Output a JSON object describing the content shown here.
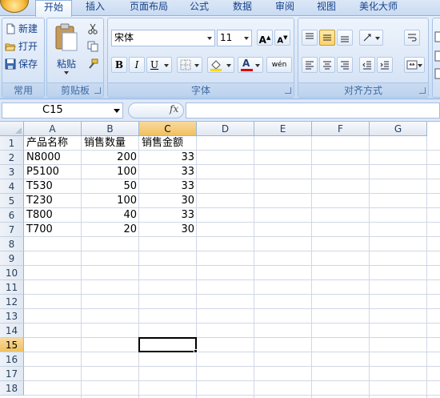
{
  "tabs": [
    {
      "label": "开始",
      "active": true
    },
    {
      "label": "插入",
      "active": false
    },
    {
      "label": "页面布局",
      "active": false
    },
    {
      "label": "公式",
      "active": false
    },
    {
      "label": "数据",
      "active": false
    },
    {
      "label": "审阅",
      "active": false
    },
    {
      "label": "视图",
      "active": false
    },
    {
      "label": "美化大师",
      "active": false
    }
  ],
  "groups": {
    "common": {
      "label": "常用",
      "new_label": "新建",
      "open_label": "打开",
      "save_label": "保存"
    },
    "clipboard": {
      "label": "剪贴板",
      "paste_label": "粘贴"
    },
    "font": {
      "label": "字体",
      "font_name": "宋体",
      "font_size": "11",
      "bold": "B",
      "italic": "I",
      "underline": "U",
      "grow": "A",
      "shrink": "A",
      "font_color_glyph": "A",
      "phonetic": "wén"
    },
    "alignment": {
      "label": "对齐方式"
    }
  },
  "formula_bar": {
    "name_box": "C15",
    "fx": "fx",
    "formula": ""
  },
  "sheet": {
    "columns": [
      "A",
      "B",
      "C",
      "D",
      "E",
      "F",
      "G"
    ],
    "selected_column": "C",
    "rows": [
      "1",
      "2",
      "3",
      "4",
      "5",
      "6",
      "7",
      "8",
      "9",
      "10",
      "11",
      "12",
      "13",
      "14",
      "15",
      "16",
      "17",
      "18"
    ],
    "selected_row": "15",
    "active_cell": "C15",
    "cells": [
      [
        "产品名称",
        "销售数量",
        "销售金额"
      ],
      [
        "N8000",
        "200",
        "33"
      ],
      [
        "P5100",
        "100",
        "33"
      ],
      [
        "T530",
        "50",
        "33"
      ],
      [
        "T230",
        "100",
        "30"
      ],
      [
        "T800",
        "40",
        "33"
      ],
      [
        "T700",
        "20",
        "30"
      ]
    ]
  },
  "colors": {
    "ribbon_text": "#15428b",
    "header_selected": "#f1c15f",
    "grid_line": "#d0d7e5"
  }
}
